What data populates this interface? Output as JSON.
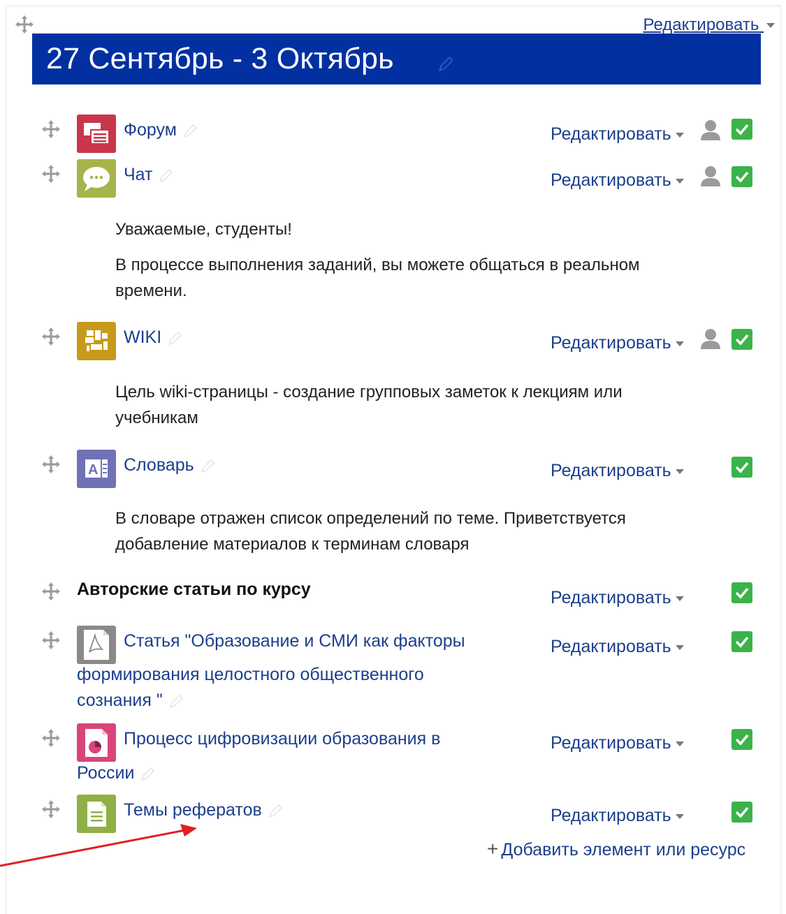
{
  "section": {
    "title": "27 Сентябрь - 3 Октябрь",
    "edit_label": "Редактировать"
  },
  "activities": [
    {
      "name": "Форум",
      "type": "forum",
      "edit_label": "Редактировать",
      "icon": "forum-icon"
    },
    {
      "name": "Чат",
      "type": "chat",
      "edit_label": "Редактировать",
      "icon": "chat-icon"
    },
    {
      "name": "WIKI",
      "type": "wiki",
      "edit_label": "Редактировать",
      "icon": "wiki-icon"
    },
    {
      "name": "Словарь",
      "type": "glossary",
      "edit_label": "Редактировать",
      "icon": "glossary-icon"
    }
  ],
  "descriptions": {
    "chat_line1": "Уважаемые, студенты!",
    "chat_line2": "В процессе выполнения заданий, вы можете общаться в реальном",
    "chat_line3": "времени.",
    "wiki_line1": "Цель wiki-страницы - создание групповых заметок к лекциям или",
    "wiki_line2": "учебникам",
    "glossary_line1": "В словаре отражен список определений по теме. Приветствуется",
    "glossary_line2": "добавление материалов к терминам словаря"
  },
  "label_item": {
    "text": "Авторские статьи по курсу",
    "edit_label": "Редактировать"
  },
  "resources": [
    {
      "line1": "Статья \"Образование и СМИ как факторы",
      "line2": "формирования целостного общественного",
      "line3": "сознания \"",
      "edit_label": "Редактировать",
      "icon": "pdf-icon"
    },
    {
      "line1": "Процесс цифровизации образования в",
      "line2": "России",
      "edit_label": "Редактировать",
      "icon": "presentation-icon"
    },
    {
      "line1": "Темы рефератов",
      "edit_label": "Редактировать",
      "icon": "page-icon"
    }
  ],
  "add_activity_label": "Добавить элемент или ресурс",
  "colors": {
    "banner": "#0330a1",
    "link": "#1c3f8c",
    "check": "#3bb34a",
    "forum": "#c9364b",
    "chat": "#a6b44a",
    "wiki": "#c79a1c",
    "glossary": "#6f72b4",
    "presentation": "#d9457a",
    "page": "#8fb044",
    "arrow": "#e02020"
  }
}
